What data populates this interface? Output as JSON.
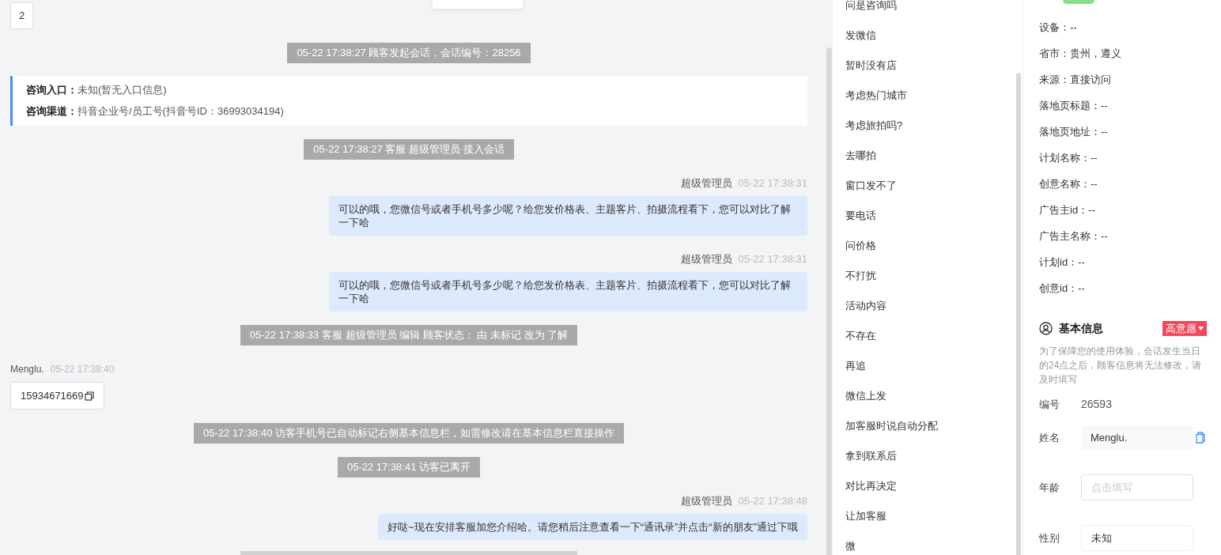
{
  "chat": {
    "messages": [
      {
        "kind": "visitor-plain",
        "text": "2"
      },
      {
        "kind": "system",
        "text": "05-22 17:38:27 顾客发起会话，会话编号：28256"
      },
      {
        "kind": "info",
        "lines": [
          {
            "label": "咨询入口：",
            "value": "未知(暂无入口信息)"
          },
          {
            "label": "咨询渠道：",
            "value": "抖音企业号/员工号(抖音号ID：36993034194)"
          }
        ]
      },
      {
        "kind": "system",
        "text": "05-22 17:38:27 客服 超级管理员 接入会话"
      },
      {
        "kind": "agent",
        "name": "超级管理员",
        "time": "05-22 17:38:31",
        "text": "可以的哦，您微信号或者手机号多少呢？给您发价格表、主题客片、拍摄流程看下，您可以对比了解一下哈"
      },
      {
        "kind": "agent",
        "name": "超级管理员",
        "time": "05-22 17:38:31",
        "text": "可以的哦，您微信号或者手机号多少呢？给您发价格表、主题客片、拍摄流程看下，您可以对比了解一下哈"
      },
      {
        "kind": "system",
        "text": "05-22 17:38:33 客服 超级管理员 编辑 顾客状态： 由 未标记 改为 了解"
      },
      {
        "kind": "visitor",
        "name": "Menglu.",
        "time": "05-22 17:38:40",
        "text": "15934671669"
      },
      {
        "kind": "system",
        "text": "05-22 17:38:40 访客手机号已自动标记右侧基本信息栏，如需修改请在基本信息栏直接操作"
      },
      {
        "kind": "system",
        "text": "05-22 17:38:41 访客已离开"
      },
      {
        "kind": "agent",
        "name": "超级管理员",
        "time": "05-22 17:38:48",
        "text": "好哒~现在安排客服加您介绍哈。请您稍后注意查看一下“通讯录”并点击“新的朋友”通过下哦"
      },
      {
        "kind": "system-cut"
      }
    ]
  },
  "quick_replies": [
    "问是咨询吗",
    "发微信",
    "暂时没有店",
    "考虑热门城市",
    "考虑旅拍吗?",
    "去哪拍",
    "窗口发不了",
    "要电话",
    "问价格",
    "不打扰",
    "活动内容",
    "不存在",
    "再追",
    "微信上发",
    "加客服时说自动分配",
    "拿到联系后",
    "对比再决定",
    "让加客服",
    "微"
  ],
  "visitor_info": [
    "设备：--",
    "省市：贵州，遵义",
    "来源：直接访问",
    "落地页标题：--",
    "落地页地址：--",
    "计划名称：--",
    "创意名称：--",
    "广告主id：--",
    "广告主名称：--",
    "计划id：--",
    "创意id：--"
  ],
  "basic_info": {
    "title": "基本信息",
    "tag": "高意愿",
    "note": "为了保障您的使用体验，会话发生当日的24点之后，顾客信息将无法修改，请及时填写",
    "fields": [
      {
        "kind": "text",
        "label": "编号",
        "value": "26593"
      },
      {
        "kind": "filled",
        "label": "姓名",
        "value": "Menglu."
      },
      {
        "kind": "input",
        "label": "年龄",
        "placeholder": "点击填写"
      },
      {
        "kind": "input",
        "label": "性别",
        "value": "未知"
      }
    ]
  }
}
